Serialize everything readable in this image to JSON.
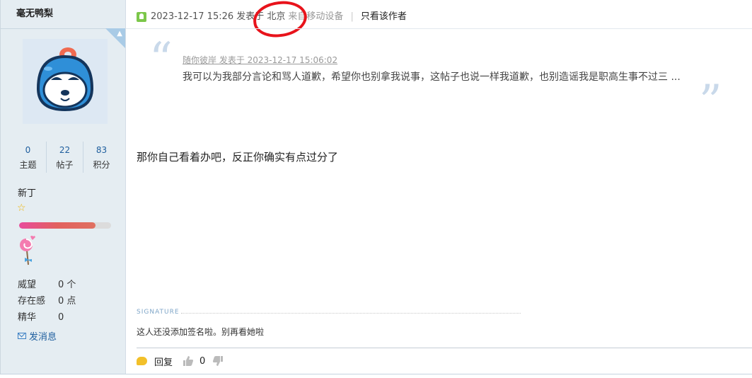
{
  "user": {
    "name": "毫无鸭梨",
    "stats": [
      {
        "value": "0",
        "label": "主题"
      },
      {
        "value": "22",
        "label": "帖子"
      },
      {
        "value": "83",
        "label": "积分"
      }
    ],
    "rank": "新丁",
    "level_progress": 0.83,
    "info": [
      {
        "key": "威望",
        "value": "0 个"
      },
      {
        "key": "存在感",
        "value": "0 点"
      },
      {
        "key": "精华",
        "value": "0"
      }
    ],
    "send_message": "发消息"
  },
  "post": {
    "time_text": "2023-12-17 15:26 发表于 北京",
    "device": "来自移动设备",
    "separator": "|",
    "only_author": "只看该作者",
    "quote": {
      "header": "随你彼岸 发表于 2023-12-17 15:06:02",
      "body": "我可以为我部分言论和骂人道歉，希望你也别拿我说事，这帖子也说一样我道歉，也别造谣我是职高生事不过三 ..."
    },
    "body": "那你自己看着办吧，反正你确实有点过分了",
    "signature_label": "SIGNATURE",
    "signature": "这人还没添加签名啦。别再看她啦",
    "reply_label": "回复",
    "like_count": "0"
  },
  "colors": {
    "sidebar_bg": "#e5edf2",
    "link_blue": "#1e5e9e",
    "annotation_red": "#e8131b"
  }
}
